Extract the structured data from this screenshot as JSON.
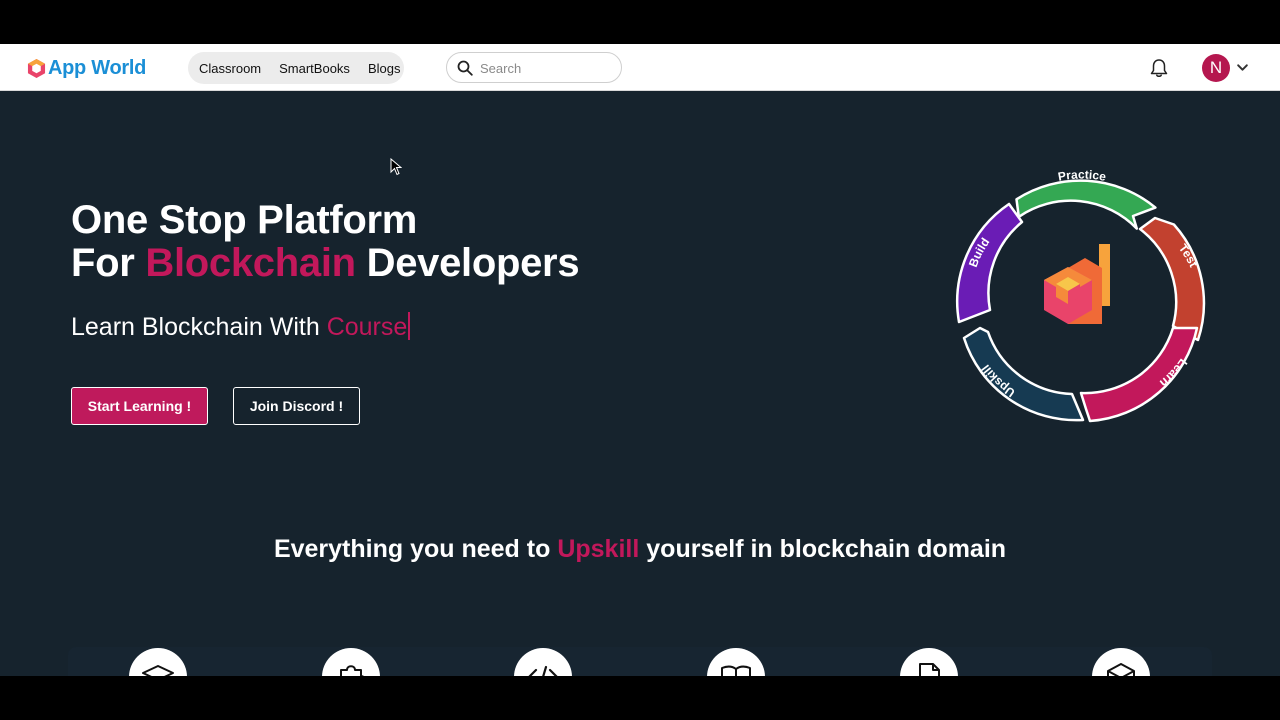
{
  "brand": {
    "name": "App World"
  },
  "nav": {
    "links": [
      {
        "label": "Classroom"
      },
      {
        "label": "SmartBooks"
      },
      {
        "label": "Blogs"
      }
    ]
  },
  "search": {
    "placeholder": "Search"
  },
  "header_icons": {
    "notifications": "bell-icon",
    "menu": "chevron-down-icon"
  },
  "user": {
    "initial": "N",
    "avatar_color": "#b5174f"
  },
  "hero": {
    "title_line1": "One Stop Platform",
    "title_line2_prefix": "For",
    "title_line2_accent": "Blockchain",
    "title_line2_suffix": "Developers",
    "subtitle_prefix": "Learn Blockchain With",
    "subtitle_accent": "Course",
    "primary_button": "Start Learning !",
    "secondary_button": "Join Discord !"
  },
  "cycle": {
    "segments": [
      {
        "label": "Practice",
        "color": "#34a853"
      },
      {
        "label": "Test",
        "color": "#c2412f"
      },
      {
        "label": "Learn",
        "color": "#c2185b"
      },
      {
        "label": "Upskill",
        "color": "#163a52"
      },
      {
        "label": "Build",
        "color": "#6a1cb5"
      }
    ]
  },
  "tagline": {
    "prefix": "Everything you need to",
    "accent": "Upskill",
    "suffix": "yourself in blockchain domain"
  },
  "features": [
    {
      "icon": "graduation-cap-icon"
    },
    {
      "icon": "puzzle-icon"
    },
    {
      "icon": "code-icon"
    },
    {
      "icon": "book-icon"
    },
    {
      "icon": "document-icon"
    },
    {
      "icon": "cube-icon"
    }
  ],
  "colors": {
    "accent": "#c2185b",
    "hero_background": "#16232d",
    "brand_blue": "#1b8fd6"
  }
}
